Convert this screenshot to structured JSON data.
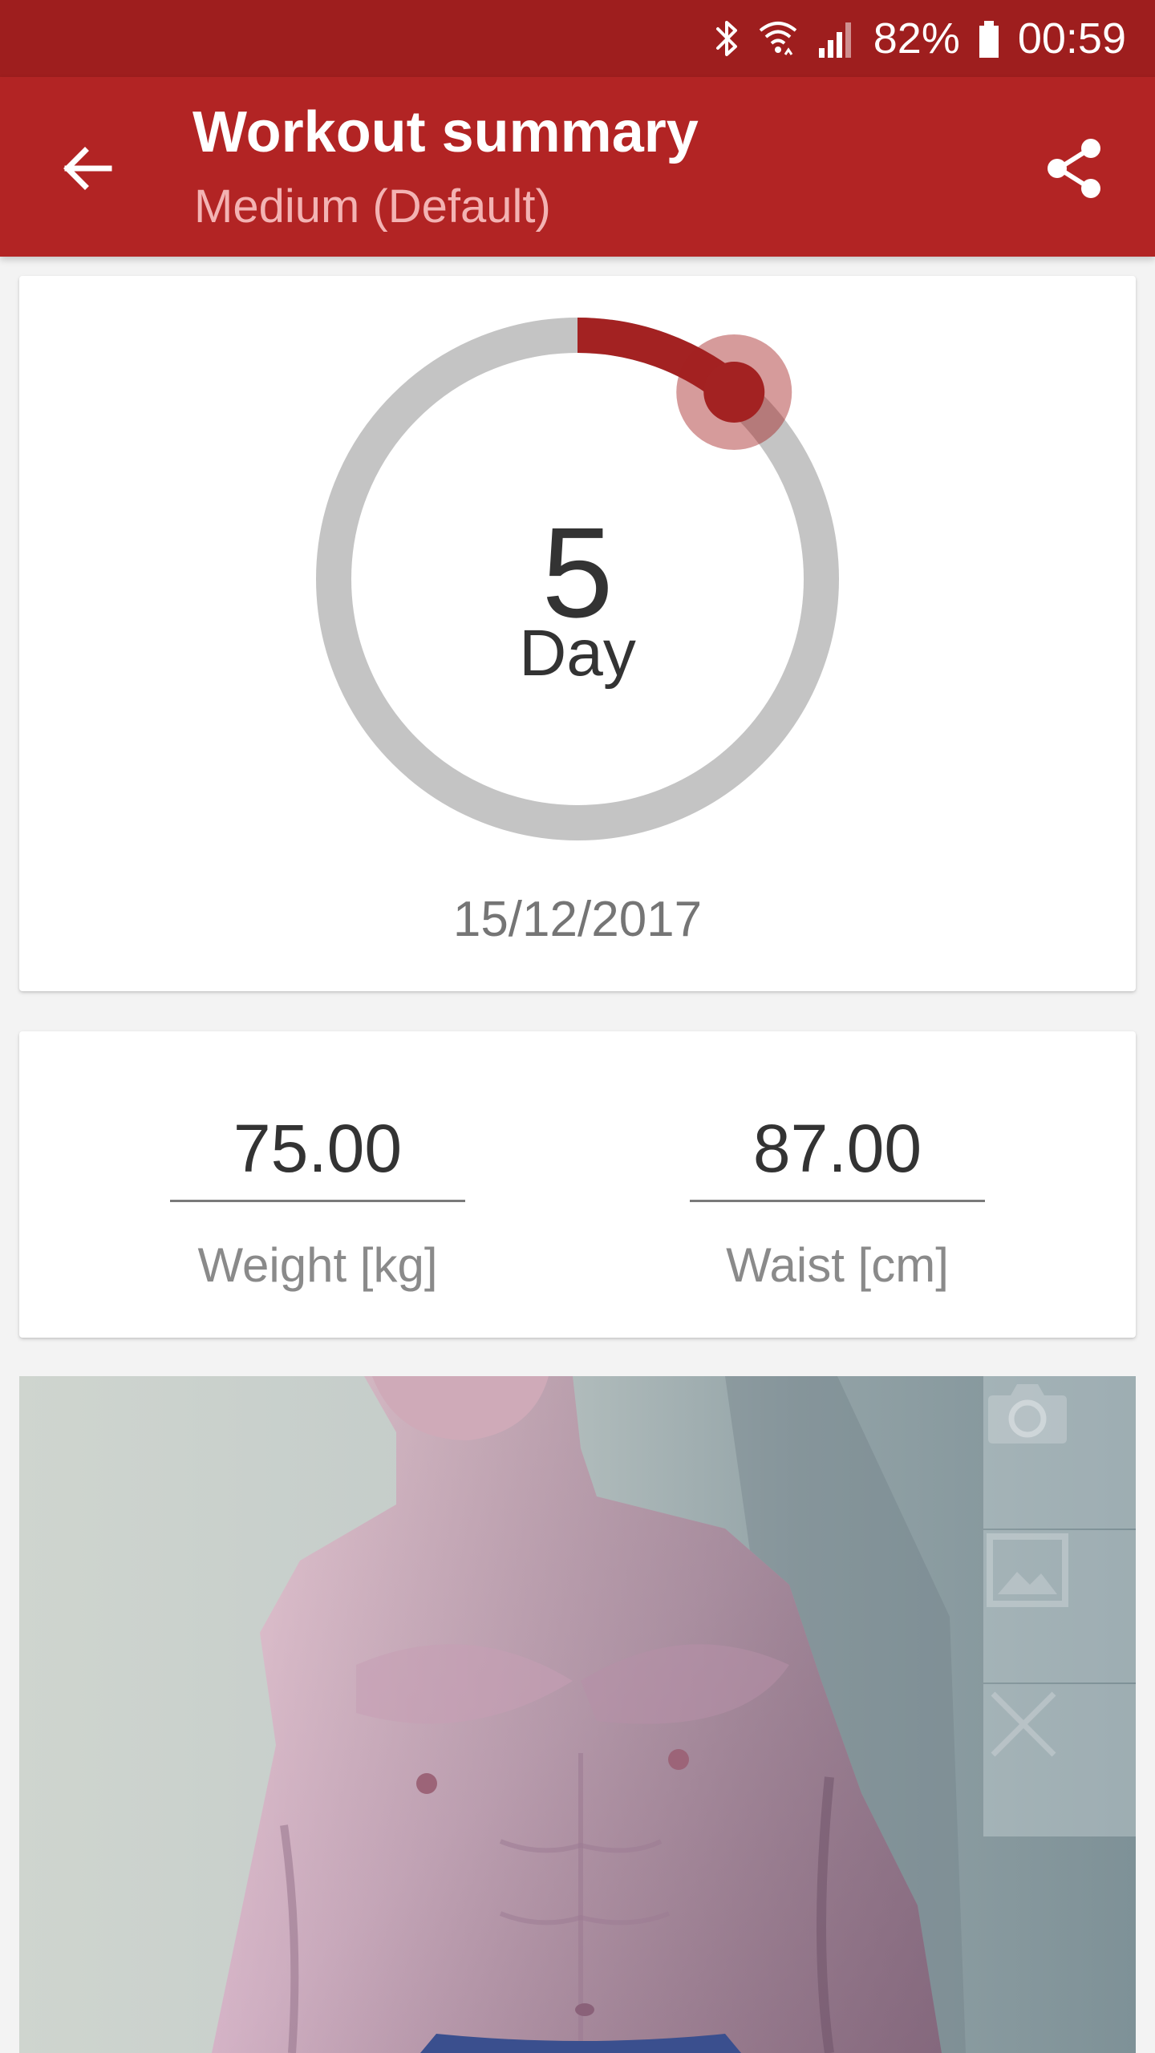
{
  "status_bar": {
    "battery_percent": "82%",
    "time": "00:59",
    "icons": [
      "bluetooth-icon",
      "wifi-icon",
      "signal-icon",
      "battery-icon"
    ]
  },
  "app_bar": {
    "title": "Workout summary",
    "subtitle": "Medium (Default)",
    "back_icon": "arrow-back-icon",
    "share_icon": "share-icon"
  },
  "progress": {
    "day_number": "5",
    "day_label": "Day",
    "date": "15/12/2017",
    "fraction": 0.111,
    "track_color": "#c4c4c4",
    "fill_color": "#a32222"
  },
  "measurements": {
    "weight": {
      "value": "75.00",
      "label": "Weight [kg]"
    },
    "waist": {
      "value": "87.00",
      "label": "Waist [cm]"
    }
  },
  "photo": {
    "actions": [
      "camera-icon",
      "gallery-icon",
      "close-icon"
    ]
  },
  "colors": {
    "status_bar": "#9e1e1e",
    "app_bar": "#b22424",
    "accent": "#a32222"
  }
}
